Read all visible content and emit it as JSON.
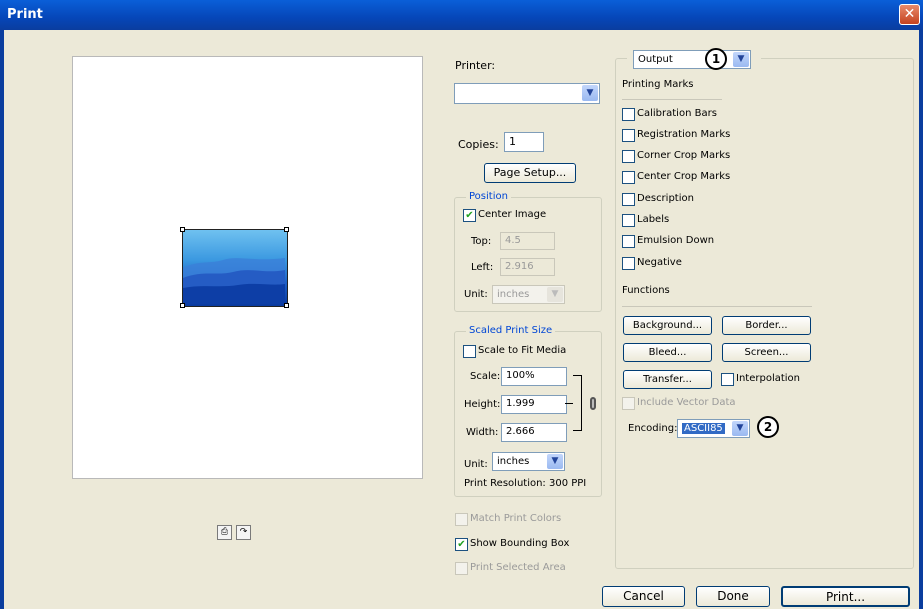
{
  "window": {
    "title": "Print",
    "close_glyph": "✕"
  },
  "printer": {
    "label": "Printer:",
    "value": ""
  },
  "copies": {
    "label": "Copies:",
    "value": "1"
  },
  "page_setup_label": "Page Setup...",
  "position": {
    "title": "Position",
    "center_image": {
      "label": "Center Image",
      "checked": true
    },
    "top": {
      "label": "Top:",
      "value": "4.5"
    },
    "left": {
      "label": "Left:",
      "value": "2.916"
    },
    "unit": {
      "label": "Unit:",
      "value": "inches"
    }
  },
  "scaled": {
    "title": "Scaled Print Size",
    "scale_to_fit": {
      "label": "Scale to Fit Media",
      "checked": false
    },
    "scale": {
      "label": "Scale:",
      "value": "100%"
    },
    "height": {
      "label": "Height:",
      "value": "1.999"
    },
    "width": {
      "label": "Width:",
      "value": "2.666"
    },
    "unit": {
      "label": "Unit:",
      "value": "inches"
    },
    "resolution": "Print Resolution: 300 PPI"
  },
  "bottom_checks": {
    "match_print_colors": {
      "label": "Match Print Colors",
      "checked": false,
      "enabled": false
    },
    "show_bounding_box": {
      "label": "Show Bounding Box",
      "checked": true,
      "enabled": true
    },
    "print_selected_area": {
      "label": "Print Selected Area",
      "checked": false,
      "enabled": false
    }
  },
  "output": {
    "dropdown_value": "Output",
    "printing_marks_heading": "Printing Marks",
    "marks": [
      {
        "label": "Calibration Bars",
        "checked": false
      },
      {
        "label": "Registration Marks",
        "checked": false
      },
      {
        "label": "Corner Crop Marks",
        "checked": false
      },
      {
        "label": "Center Crop Marks",
        "checked": false
      },
      {
        "label": "Description",
        "checked": false
      },
      {
        "label": "Labels",
        "checked": false
      },
      {
        "label": "Emulsion Down",
        "checked": false
      },
      {
        "label": "Negative",
        "checked": false
      }
    ],
    "functions_heading": "Functions",
    "buttons": {
      "background": "Background...",
      "border": "Border...",
      "bleed": "Bleed...",
      "screen": "Screen...",
      "transfer": "Transfer..."
    },
    "interpolation": {
      "label": "Interpolation",
      "checked": false
    },
    "include_vector": {
      "label": "Include Vector Data",
      "checked": false,
      "enabled": false
    },
    "encoding": {
      "label": "Encoding:",
      "value": "ASCII85"
    }
  },
  "callouts": [
    "1",
    "2"
  ],
  "footer": {
    "cancel": "Cancel",
    "done": "Done",
    "print": "Print..."
  },
  "icons": {
    "dropdown_arrow": "chevron-down-icon",
    "link": "chain-link-icon",
    "check": "checkmark-icon"
  },
  "colors": {
    "titlebar": "#0646b8",
    "dialog_bg": "#ece9d8",
    "group_title": "#0046d5",
    "encoding_selected": "#316ac5"
  }
}
